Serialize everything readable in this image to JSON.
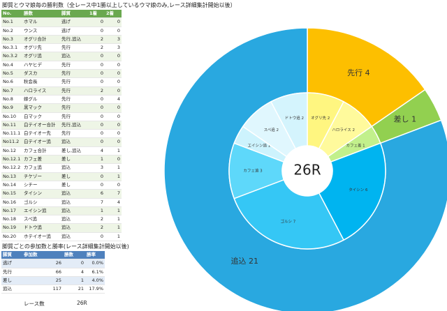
{
  "wins_title": "脚質とウマ娘毎の勝利数（全レース中1勝以上しているウマ娘のみ,レース詳細集計開始以後）",
  "wins_table": {
    "headers": [
      "No.",
      "勝数",
      "脚質",
      "1着",
      "2着"
    ],
    "rows": [
      [
        "No.1",
        "ホマル",
        "逃げ",
        "0",
        "0"
      ],
      [
        "No.2",
        "ウンス",
        "逃げ",
        "0",
        "0"
      ],
      [
        "No.3",
        "オグリ合計",
        "先行,追込",
        "2",
        "3"
      ],
      [
        "No.3.1",
        "オグリ先",
        "先行",
        "2",
        "3"
      ],
      [
        "No.3.2",
        "オグリ追",
        "追込",
        "0",
        "0"
      ],
      [
        "No.4",
        "ハヤヒデ",
        "先行",
        "0",
        "0"
      ],
      [
        "No.5",
        "ダスカ",
        "先行",
        "0",
        "0"
      ],
      [
        "No.6",
        "秋会長",
        "先行",
        "0",
        "0"
      ],
      [
        "No.7",
        "ハロライス",
        "先行",
        "2",
        "0"
      ],
      [
        "No.8",
        "嫁グル",
        "先行",
        "0",
        "4"
      ],
      [
        "No.9",
        "黒マック",
        "先行",
        "0",
        "0"
      ],
      [
        "No.10",
        "白マック",
        "先行",
        "0",
        "0"
      ],
      [
        "No.11",
        "白テイオー合計",
        "先行,追込",
        "0",
        "0"
      ],
      [
        "No.11.1",
        "白テイオー先",
        "先行",
        "0",
        "0"
      ],
      [
        "No11.2",
        "白テイオー追",
        "追込",
        "0",
        "0"
      ],
      [
        "No.12",
        "カフェ合計",
        "差し,追込",
        "4",
        "1"
      ],
      [
        "No.12.1",
        "カフェ差",
        "差し",
        "1",
        "0"
      ],
      [
        "No.12.2",
        "カフェ追",
        "追込",
        "3",
        "1"
      ],
      [
        "No.13",
        "チケゾー",
        "差し",
        "0",
        "1"
      ],
      [
        "No.14",
        "シチー",
        "差し",
        "0",
        "0"
      ],
      [
        "No.15",
        "タイシン",
        "追込",
        "6",
        "7"
      ],
      [
        "No.16",
        "ゴルシ",
        "追込",
        "7",
        "4"
      ],
      [
        "No.17",
        "エイシン追",
        "追込",
        "1",
        "1"
      ],
      [
        "No.18",
        "スペ追",
        "追込",
        "2",
        "1"
      ],
      [
        "No.19",
        "ドトウ追",
        "追込",
        "2",
        "1"
      ],
      [
        "No.20",
        "ホテイオー追",
        "追込",
        "0",
        "1"
      ]
    ]
  },
  "rate_title": "脚質ごとの参加数と勝率(レース詳細集計開始以後)",
  "rate_table": {
    "headers": [
      "脚質",
      "参加数",
      "勝数",
      "勝率"
    ],
    "rows": [
      [
        "逃げ",
        "26",
        "0",
        "0.0%"
      ],
      [
        "先行",
        "66",
        "4",
        "6.1%"
      ],
      [
        "差し",
        "25",
        "1",
        "4.0%"
      ],
      [
        "追込",
        "117",
        "21",
        "17.9%"
      ]
    ]
  },
  "race_count": {
    "label": "レース数",
    "value": "26R"
  },
  "chart_data": {
    "type": "pie",
    "title": "",
    "center_label": "26R",
    "outer": [
      {
        "name": "先行",
        "value": 4,
        "color": "#fdbf00"
      },
      {
        "name": "差し",
        "value": 1,
        "color": "#92d050"
      },
      {
        "name": "追込",
        "value": 21,
        "color": "#29a8e0"
      }
    ],
    "inner": [
      {
        "name": "オグリ先",
        "value": 2,
        "color": "#fff680"
      },
      {
        "name": "ハロライス",
        "value": 2,
        "color": "#fffa9c"
      },
      {
        "name": "カフェ差",
        "value": 1,
        "color": "#c2f08c"
      },
      {
        "name": "タイシン",
        "value": 6,
        "color": "#00b4f0"
      },
      {
        "name": "ゴルシ",
        "value": 7,
        "color": "#35c7f5"
      },
      {
        "name": "カフェ追",
        "value": 3,
        "color": "#5ed8fa"
      },
      {
        "name": "エイシン追",
        "value": 1,
        "color": "#cdf3fd"
      },
      {
        "name": "スペ追",
        "value": 2,
        "color": "#e0f7fe"
      },
      {
        "name": "ドトウ追",
        "value": 2,
        "color": "#d4f4fd"
      }
    ]
  }
}
